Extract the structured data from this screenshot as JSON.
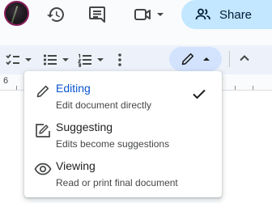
{
  "header": {
    "share_label": "Share"
  },
  "ruler": {
    "marker": "6"
  },
  "mode_menu": {
    "items": [
      {
        "title": "Editing",
        "description": "Edit document directly",
        "selected": true,
        "icon": "pencil-icon"
      },
      {
        "title": "Suggesting",
        "description": "Edits become suggestions",
        "selected": false,
        "icon": "suggest-edit-icon"
      },
      {
        "title": "Viewing",
        "description": "Read or print final document",
        "selected": false,
        "icon": "eye-icon"
      }
    ]
  },
  "colors": {
    "share_background": "#c2e7ff",
    "mode_button_background": "#d3e3fd",
    "selected_text": "#0b57d0",
    "toolbar_background": "#edf2fa"
  }
}
